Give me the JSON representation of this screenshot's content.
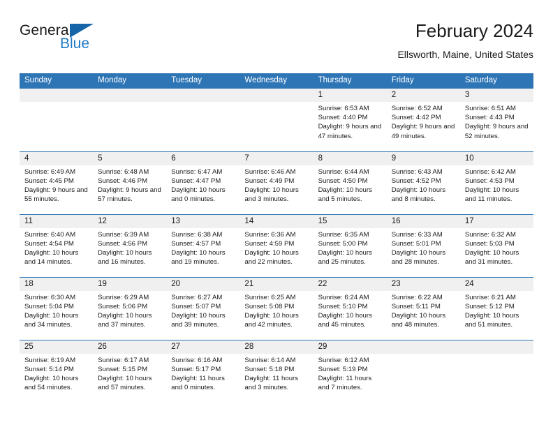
{
  "brand": {
    "name_primary": "General",
    "name_secondary": "Blue",
    "triangle_color": "#1565a8",
    "secondary_color": "#1f7ac4"
  },
  "header": {
    "title": "February 2024",
    "location": "Ellsworth, Maine, United States"
  },
  "theme": {
    "header_bar_color": "#2e75b6",
    "daynum_band_color": "#f0f0f0",
    "text_color": "#1a1a1a"
  },
  "calendar": {
    "weekday_headers": [
      "Sunday",
      "Monday",
      "Tuesday",
      "Wednesday",
      "Thursday",
      "Friday",
      "Saturday"
    ],
    "weeks": [
      [
        {
          "day": "",
          "blank": true
        },
        {
          "day": "",
          "blank": true
        },
        {
          "day": "",
          "blank": true
        },
        {
          "day": "",
          "blank": true
        },
        {
          "day": "1",
          "sunrise": "Sunrise: 6:53 AM",
          "sunset": "Sunset: 4:40 PM",
          "daylight": "Daylight: 9 hours and 47 minutes."
        },
        {
          "day": "2",
          "sunrise": "Sunrise: 6:52 AM",
          "sunset": "Sunset: 4:42 PM",
          "daylight": "Daylight: 9 hours and 49 minutes."
        },
        {
          "day": "3",
          "sunrise": "Sunrise: 6:51 AM",
          "sunset": "Sunset: 4:43 PM",
          "daylight": "Daylight: 9 hours and 52 minutes."
        }
      ],
      [
        {
          "day": "4",
          "sunrise": "Sunrise: 6:49 AM",
          "sunset": "Sunset: 4:45 PM",
          "daylight": "Daylight: 9 hours and 55 minutes."
        },
        {
          "day": "5",
          "sunrise": "Sunrise: 6:48 AM",
          "sunset": "Sunset: 4:46 PM",
          "daylight": "Daylight: 9 hours and 57 minutes."
        },
        {
          "day": "6",
          "sunrise": "Sunrise: 6:47 AM",
          "sunset": "Sunset: 4:47 PM",
          "daylight": "Daylight: 10 hours and 0 minutes."
        },
        {
          "day": "7",
          "sunrise": "Sunrise: 6:46 AM",
          "sunset": "Sunset: 4:49 PM",
          "daylight": "Daylight: 10 hours and 3 minutes."
        },
        {
          "day": "8",
          "sunrise": "Sunrise: 6:44 AM",
          "sunset": "Sunset: 4:50 PM",
          "daylight": "Daylight: 10 hours and 5 minutes."
        },
        {
          "day": "9",
          "sunrise": "Sunrise: 6:43 AM",
          "sunset": "Sunset: 4:52 PM",
          "daylight": "Daylight: 10 hours and 8 minutes."
        },
        {
          "day": "10",
          "sunrise": "Sunrise: 6:42 AM",
          "sunset": "Sunset: 4:53 PM",
          "daylight": "Daylight: 10 hours and 11 minutes."
        }
      ],
      [
        {
          "day": "11",
          "sunrise": "Sunrise: 6:40 AM",
          "sunset": "Sunset: 4:54 PM",
          "daylight": "Daylight: 10 hours and 14 minutes."
        },
        {
          "day": "12",
          "sunrise": "Sunrise: 6:39 AM",
          "sunset": "Sunset: 4:56 PM",
          "daylight": "Daylight: 10 hours and 16 minutes."
        },
        {
          "day": "13",
          "sunrise": "Sunrise: 6:38 AM",
          "sunset": "Sunset: 4:57 PM",
          "daylight": "Daylight: 10 hours and 19 minutes."
        },
        {
          "day": "14",
          "sunrise": "Sunrise: 6:36 AM",
          "sunset": "Sunset: 4:59 PM",
          "daylight": "Daylight: 10 hours and 22 minutes."
        },
        {
          "day": "15",
          "sunrise": "Sunrise: 6:35 AM",
          "sunset": "Sunset: 5:00 PM",
          "daylight": "Daylight: 10 hours and 25 minutes."
        },
        {
          "day": "16",
          "sunrise": "Sunrise: 6:33 AM",
          "sunset": "Sunset: 5:01 PM",
          "daylight": "Daylight: 10 hours and 28 minutes."
        },
        {
          "day": "17",
          "sunrise": "Sunrise: 6:32 AM",
          "sunset": "Sunset: 5:03 PM",
          "daylight": "Daylight: 10 hours and 31 minutes."
        }
      ],
      [
        {
          "day": "18",
          "sunrise": "Sunrise: 6:30 AM",
          "sunset": "Sunset: 5:04 PM",
          "daylight": "Daylight: 10 hours and 34 minutes."
        },
        {
          "day": "19",
          "sunrise": "Sunrise: 6:29 AM",
          "sunset": "Sunset: 5:06 PM",
          "daylight": "Daylight: 10 hours and 37 minutes."
        },
        {
          "day": "20",
          "sunrise": "Sunrise: 6:27 AM",
          "sunset": "Sunset: 5:07 PM",
          "daylight": "Daylight: 10 hours and 39 minutes."
        },
        {
          "day": "21",
          "sunrise": "Sunrise: 6:25 AM",
          "sunset": "Sunset: 5:08 PM",
          "daylight": "Daylight: 10 hours and 42 minutes."
        },
        {
          "day": "22",
          "sunrise": "Sunrise: 6:24 AM",
          "sunset": "Sunset: 5:10 PM",
          "daylight": "Daylight: 10 hours and 45 minutes."
        },
        {
          "day": "23",
          "sunrise": "Sunrise: 6:22 AM",
          "sunset": "Sunset: 5:11 PM",
          "daylight": "Daylight: 10 hours and 48 minutes."
        },
        {
          "day": "24",
          "sunrise": "Sunrise: 6:21 AM",
          "sunset": "Sunset: 5:12 PM",
          "daylight": "Daylight: 10 hours and 51 minutes."
        }
      ],
      [
        {
          "day": "25",
          "sunrise": "Sunrise: 6:19 AM",
          "sunset": "Sunset: 5:14 PM",
          "daylight": "Daylight: 10 hours and 54 minutes."
        },
        {
          "day": "26",
          "sunrise": "Sunrise: 6:17 AM",
          "sunset": "Sunset: 5:15 PM",
          "daylight": "Daylight: 10 hours and 57 minutes."
        },
        {
          "day": "27",
          "sunrise": "Sunrise: 6:16 AM",
          "sunset": "Sunset: 5:17 PM",
          "daylight": "Daylight: 11 hours and 0 minutes."
        },
        {
          "day": "28",
          "sunrise": "Sunrise: 6:14 AM",
          "sunset": "Sunset: 5:18 PM",
          "daylight": "Daylight: 11 hours and 3 minutes."
        },
        {
          "day": "29",
          "sunrise": "Sunrise: 6:12 AM",
          "sunset": "Sunset: 5:19 PM",
          "daylight": "Daylight: 11 hours and 7 minutes."
        },
        {
          "day": "",
          "blank": true
        },
        {
          "day": "",
          "blank": true
        }
      ]
    ]
  }
}
